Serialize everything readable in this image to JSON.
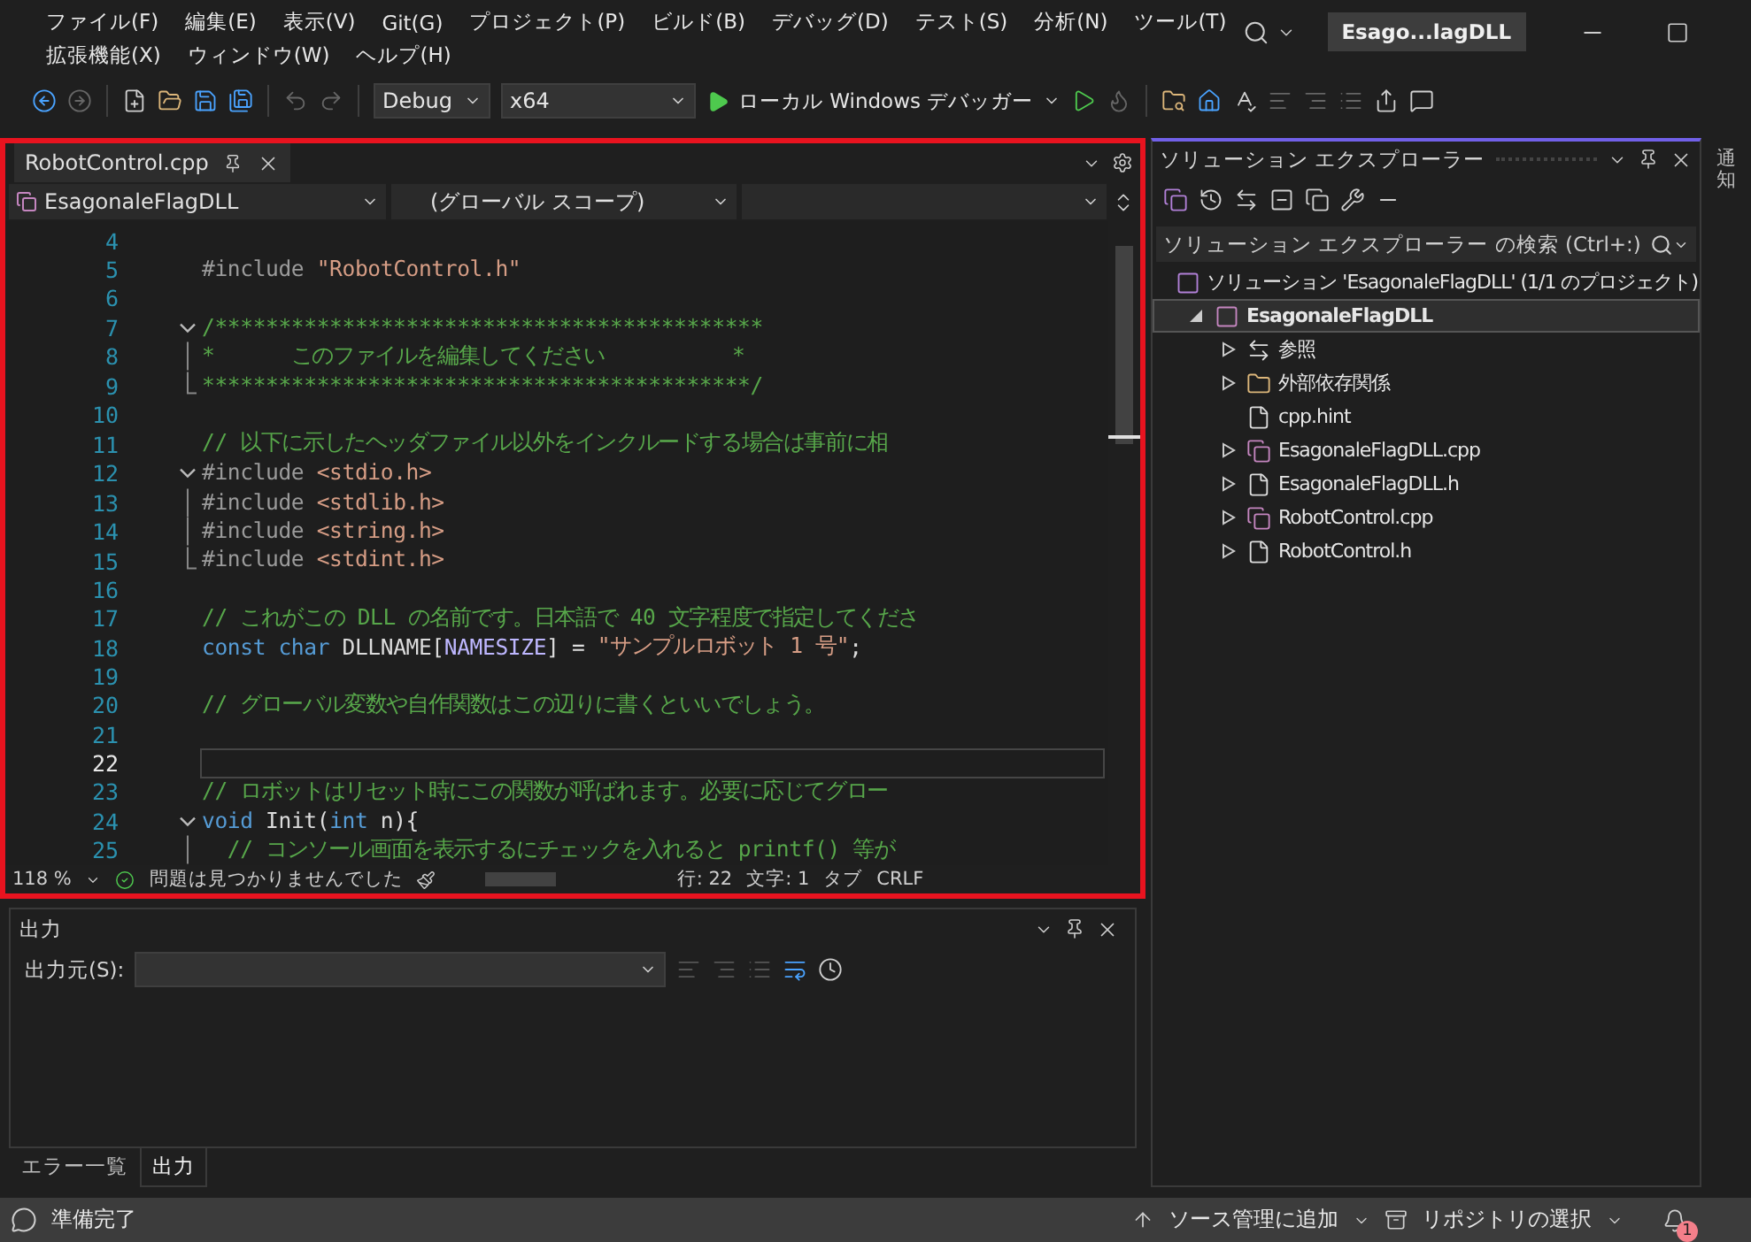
{
  "menu_rows": [
    [
      "ファイル(F)",
      "編集(E)",
      "表示(V)",
      "Git(G)",
      "プロジェクト(P)",
      "ビルド(B)",
      "デバッグ(D)",
      "テスト(S)",
      "分析(N)",
      "ツール(T)"
    ],
    [
      "拡張機能(X)",
      "ウィンドウ(W)",
      "ヘルプ(H)"
    ]
  ],
  "title_badge": "Esago...lagDLL",
  "toolbar": {
    "configuration": "Debug",
    "platform": "x64",
    "run_label": "ローカル Windows デバッガー"
  },
  "editor": {
    "tabs": [
      {
        "label": "RobotControl.cpp",
        "selected": true
      }
    ],
    "nav": {
      "project": "EsagonaleFlagDLL",
      "scope": "(グローバル スコープ)"
    },
    "lines": [
      {
        "number": "4",
        "current": false
      },
      {
        "number": "5",
        "current": false,
        "segments": [
          {
            "kind": "preproc",
            "text": "#include "
          },
          {
            "kind": "string",
            "text": "\"RobotControl.h\""
          }
        ]
      },
      {
        "number": "6",
        "current": false
      },
      {
        "number": "7",
        "current": false,
        "kind": "foldstart",
        "segments": [
          {
            "kind": "comment",
            "text": "/*******************************************"
          }
        ]
      },
      {
        "number": "8",
        "current": false,
        "kind": "foldbody",
        "segments": [
          {
            "kind": "comment",
            "text": "*      このファイルを編集してください          *"
          }
        ]
      },
      {
        "number": "9",
        "current": false,
        "kind": "foldend",
        "segments": [
          {
            "kind": "comment",
            "text": "*******************************************/"
          }
        ]
      },
      {
        "number": "10",
        "current": false
      },
      {
        "number": "11",
        "current": false,
        "segments": [
          {
            "kind": "comment",
            "text": "// 以下に示したヘッダファイル以外をインクルードする場合は事前に相"
          }
        ]
      },
      {
        "number": "12",
        "current": false,
        "kind": "foldstart",
        "segments": [
          {
            "kind": "preproc",
            "text": "#include "
          },
          {
            "kind": "string",
            "text": "<stdio.h>"
          }
        ]
      },
      {
        "number": "13",
        "current": false,
        "kind": "foldbody",
        "segments": [
          {
            "kind": "preproc",
            "text": "#include "
          },
          {
            "kind": "string",
            "text": "<stdlib.h>"
          }
        ]
      },
      {
        "number": "14",
        "current": false,
        "kind": "foldbody",
        "segments": [
          {
            "kind": "preproc",
            "text": "#include "
          },
          {
            "kind": "string",
            "text": "<string.h>"
          }
        ]
      },
      {
        "number": "15",
        "current": false,
        "kind": "foldend",
        "segments": [
          {
            "kind": "preproc",
            "text": "#include "
          },
          {
            "kind": "string",
            "text": "<stdint.h>"
          }
        ]
      },
      {
        "number": "16",
        "current": false
      },
      {
        "number": "17",
        "current": false,
        "segments": [
          {
            "kind": "comment",
            "text": "// これがこの DLL の名前です。日本語で 40 文字程度で指定してくださ"
          }
        ]
      },
      {
        "number": "18",
        "current": false,
        "segments": [
          {
            "kind": "keyword",
            "text": "const char "
          },
          {
            "kind": "plain",
            "text": "DLLNAME["
          },
          {
            "kind": "macro",
            "text": "NAMESIZE"
          },
          {
            "kind": "plain",
            "text": "] = "
          },
          {
            "kind": "string",
            "text": "\"サンプルロボット 1 号\""
          },
          {
            "kind": "plain",
            "text": ";"
          }
        ]
      },
      {
        "number": "19",
        "current": false
      },
      {
        "number": "20",
        "current": false,
        "segments": [
          {
            "kind": "comment",
            "text": "// グローバル変数や自作関数はこの辺りに書くといいでしょう。"
          }
        ]
      },
      {
        "number": "21",
        "current": false
      },
      {
        "number": "22",
        "current": true
      },
      {
        "number": "23",
        "current": false,
        "segments": [
          {
            "kind": "comment",
            "text": "// ロボットはリセット時にこの関数が呼ばれます。必要に応じてグロー"
          }
        ]
      },
      {
        "number": "24",
        "current": false,
        "kind": "foldstart",
        "segments": [
          {
            "kind": "keyword",
            "text": "void "
          },
          {
            "kind": "plain",
            "text": "Init("
          },
          {
            "kind": "keyword",
            "text": "int "
          },
          {
            "kind": "plain",
            "text": "n){"
          }
        ]
      },
      {
        "number": "25",
        "current": false,
        "kind": "foldbody",
        "segments": [
          {
            "kind": "comment",
            "text": "  // コンソール画面を表示するにチェックを入れると printf() 等が"
          }
        ]
      }
    ],
    "status": {
      "zoom": "118 %",
      "issues": "問題は見つかりませんでした",
      "line": "行: 22",
      "column": "文字: 1",
      "indent": "タブ",
      "eol": "CRLF"
    }
  },
  "output": {
    "title": "出力",
    "source_label": "出力元(S):",
    "tabs": [
      {
        "label": "エラー一覧",
        "selected": false
      },
      {
        "label": "出力",
        "selected": true
      }
    ]
  },
  "solution_explorer": {
    "title": "ソリューション エクスプローラー",
    "search": {
      "placeholder": "ソリューション エクスプローラー の検索 (Ctrl+:)"
    },
    "tree": [
      {
        "label": "ソリューション 'EsagonaleFlagDLL' (1/1 のプロジェクト)",
        "kind": "solution",
        "children": [
          {
            "label": "EsagonaleFlagDLL",
            "kind": "project",
            "expanded": true,
            "selected": true,
            "children": [
              {
                "label": "参照",
                "kind": "references",
                "expanded": false,
                "selected": false
              },
              {
                "label": "外部依存関係",
                "kind": "folder",
                "expanded": false,
                "selected": false
              },
              {
                "label": "cpp.hint",
                "kind": "file",
                "selected": false
              },
              {
                "label": "EsagonaleFlagDLL.cpp",
                "kind": "cpp",
                "expanded": false,
                "selected": false
              },
              {
                "label": "EsagonaleFlagDLL.h",
                "kind": "header",
                "expanded": false,
                "selected": false
              },
              {
                "label": "RobotControl.cpp",
                "kind": "cpp",
                "expanded": false,
                "selected": false
              },
              {
                "label": "RobotControl.h",
                "kind": "header",
                "expanded": false,
                "selected": false
              }
            ]
          }
        ]
      }
    ]
  },
  "side_tab": "通知",
  "status_bar": {
    "message": "準備完了",
    "source_control": "ソース管理に追加",
    "repository": "リポジトリの選択",
    "notifications": "1"
  }
}
